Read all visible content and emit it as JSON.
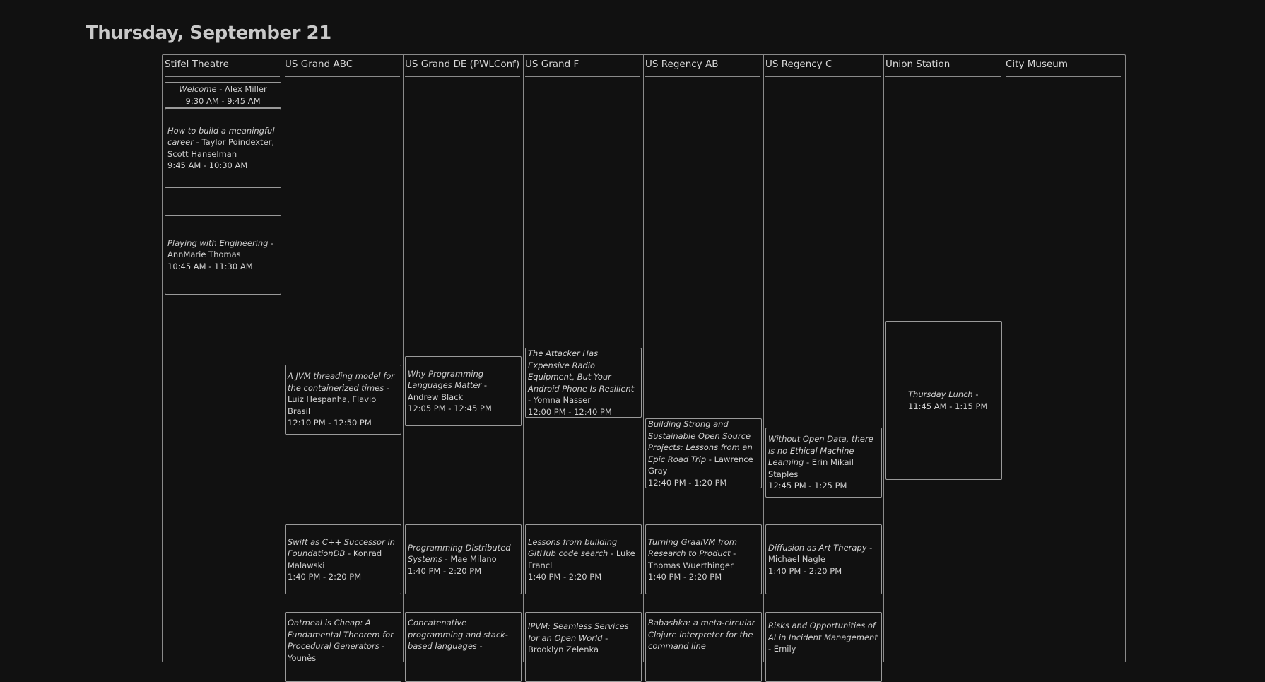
{
  "page": {
    "title": "Thursday, September 21"
  },
  "columns": [
    {
      "name": "Stifel Theatre"
    },
    {
      "name": "US Grand ABC"
    },
    {
      "name": "US Grand DE (PWLConf)"
    },
    {
      "name": "US Grand F"
    },
    {
      "name": "US Regency AB"
    },
    {
      "name": "US Regency C"
    },
    {
      "name": "Union Station"
    },
    {
      "name": "City Museum"
    }
  ],
  "events": {
    "stifel": [
      {
        "title": "Welcome",
        "speakers": " - Alex Miller",
        "time": "9:30 AM - 9:45 AM"
      },
      {
        "title": "How to build a meaningful career",
        "speakers": " - Taylor Poindexter, Scott Hanselman",
        "time": "9:45 AM - 10:30 AM"
      },
      {
        "title": "Playing with Engineering",
        "speakers": " - AnnMarie Thomas",
        "time": "10:45 AM - 11:30 AM"
      }
    ],
    "grand_abc": [
      {
        "title": "A JVM threading model for the containerized times",
        "speakers": " - Luiz Hespanha, Flavio Brasil",
        "time": "12:10 PM - 12:50 PM"
      },
      {
        "title": "Swift as C++ Successor in FoundationDB",
        "speakers": " - Konrad Malawski",
        "time": "1:40 PM - 2:20 PM"
      },
      {
        "title": "Oatmeal is Cheap: A Fundamental Theorem for Procedural Generators",
        "speakers": " - Younès",
        "time": ""
      }
    ],
    "grand_de": [
      {
        "title": "Why Programming Languages Matter",
        "speakers": " - Andrew Black",
        "time": "12:05 PM - 12:45 PM"
      },
      {
        "title": "Programming Distributed Systems",
        "speakers": " - Mae Milano",
        "time": "1:40 PM - 2:20 PM"
      },
      {
        "title": "Concatenative programming and stack-based languages",
        "speakers": " -",
        "time": ""
      }
    ],
    "grand_f": [
      {
        "title": "The Attacker Has Expensive Radio Equipment, But Your Android Phone Is Resilient",
        "speakers": " - Yomna Nasser",
        "time": "12:00 PM - 12:40 PM"
      },
      {
        "title": "Lessons from building GitHub code search",
        "speakers": " - Luke Francl",
        "time": "1:40 PM - 2:20 PM"
      },
      {
        "title": "IPVM: Seamless Services for an Open World",
        "speakers": " - Brooklyn Zelenka",
        "time": ""
      }
    ],
    "regency_ab": [
      {
        "title": "Building Strong and Sustainable Open Source Projects: Lessons from an Epic Road Trip",
        "speakers": " - Lawrence Gray",
        "time": "12:40 PM - 1:20 PM"
      },
      {
        "title": "Turning GraalVM from Research to Product",
        "speakers": " - Thomas Wuerthinger",
        "time": "1:40 PM - 2:20 PM"
      },
      {
        "title": "Babashka: a meta-circular Clojure interpreter for the command line",
        "speakers": "",
        "time": ""
      }
    ],
    "regency_c": [
      {
        "title": "Without Open Data, there is no Ethical Machine Learning",
        "speakers": " - Erin Mikail Staples",
        "time": "12:45 PM - 1:25 PM"
      },
      {
        "title": "Diffusion as Art Therapy",
        "speakers": " - Michael Nagle",
        "time": "1:40 PM - 2:20 PM"
      },
      {
        "title": "Risks and Opportunities of AI in Incident Management",
        "speakers": " - Emily",
        "time": ""
      }
    ],
    "union_station": [
      {
        "title": "Thursday Lunch",
        "speakers": " -",
        "time": "11:45 AM - 1:15 PM"
      }
    ]
  }
}
